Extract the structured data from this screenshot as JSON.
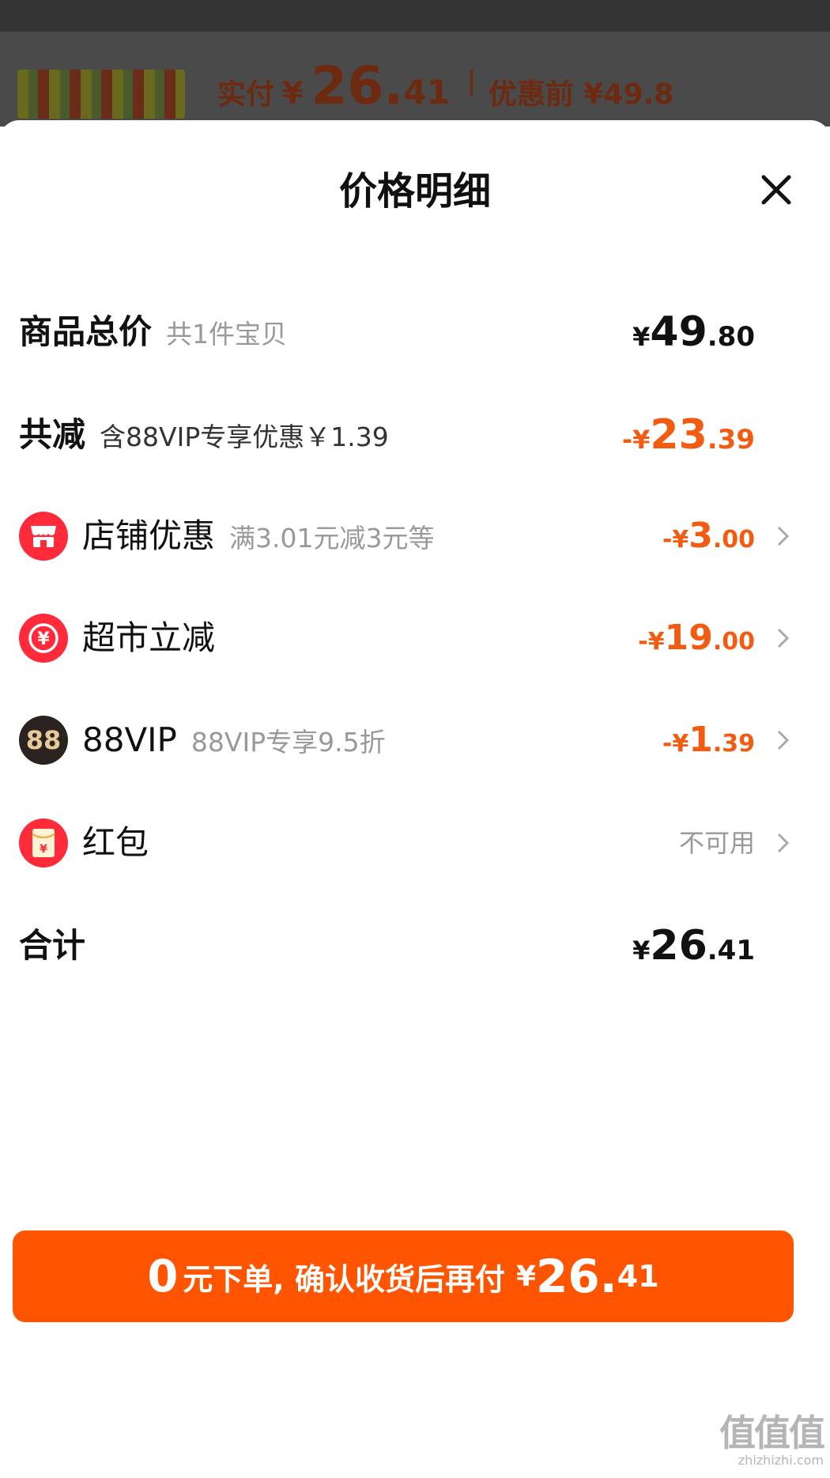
{
  "backdrop": {
    "paid_label": "实付",
    "paid_yen": "¥",
    "paid_int": "26.",
    "paid_dec": "41",
    "before_label": "优惠前 ¥49.8"
  },
  "sheet": {
    "title": "价格明细",
    "close_icon": "close-icon"
  },
  "rows": {
    "total": {
      "label": "商品总价",
      "sub": "共1件宝贝",
      "yen": "¥",
      "int": "49",
      "dec": ".80"
    },
    "reduce": {
      "label": "共减",
      "sub": "含88VIP专享优惠￥1.39",
      "yen": "-¥",
      "int": "23",
      "dec": ".39"
    },
    "shop": {
      "icon": "shop-icon",
      "label": "店铺优惠",
      "sub": "满3.01元减3元等",
      "yen": "-¥",
      "int": "3",
      "dec": ".00"
    },
    "market": {
      "icon": "yuan-coin-icon",
      "label": "超市立减",
      "yen": "-¥",
      "int": "19",
      "dec": ".00"
    },
    "vip": {
      "icon_text": "88",
      "label": "88VIP",
      "sub": "88VIP专享9.5折",
      "yen": "-¥",
      "int": "1",
      "dec": ".39"
    },
    "redpacket": {
      "icon": "red-packet-icon",
      "label": "红包",
      "status": "不可用"
    },
    "sum": {
      "label": "合计",
      "yen": "¥",
      "int": "26",
      "dec": ".41"
    }
  },
  "pay_button": {
    "zero": "0",
    "text": "元下单, 确认收货后再付",
    "yen": "¥",
    "int": "26.",
    "dec": "41"
  },
  "watermark": {
    "big": "值值值",
    "small": "zhizhizhi.com"
  },
  "colors": {
    "accent": "#ff5500",
    "discount": "#f25c12",
    "icon_red": "#ff2b3a"
  }
}
